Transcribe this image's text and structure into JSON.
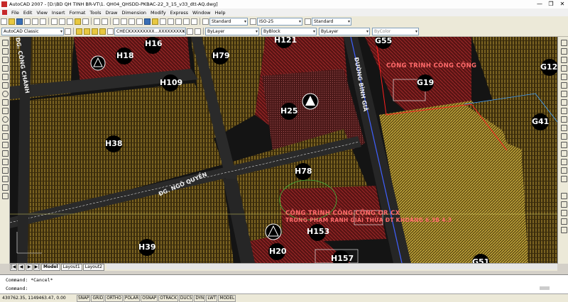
{
  "window": {
    "title": "AutoCAD 2007 - [D:\\BD QH TINH BR-VT\\1. QH04_QHSDD-PKBAC-22_3_15_v33_dtt-AQ.dwg]",
    "minimize_label": "—",
    "maximize_label": "❐",
    "close_label": "✕"
  },
  "menu": {
    "items": [
      "File",
      "Edit",
      "View",
      "Insert",
      "Format",
      "Tools",
      "Draw",
      "Dimension",
      "Modify",
      "Express",
      "Window",
      "Help"
    ]
  },
  "toolbar": {
    "text_style": "Standard",
    "dim_style": "ISO-25",
    "table_style": "Standard",
    "workspace": "AutoCAD Classic",
    "layer": "CHECKXXXXXXXX...XXXXXXXXXXXXX",
    "color": "ByLayer",
    "linetype": "ByBlock",
    "lineweight": "ByLayer",
    "plotstyle": "ByColor"
  },
  "drawing": {
    "lot_labels": [
      "H16",
      "H18",
      "H79",
      "H121",
      "G55",
      "G12",
      "H109",
      "G19",
      "H25",
      "G41",
      "H38",
      "H78",
      "H153",
      "H39",
      "H20",
      "H157",
      "G51"
    ],
    "road_labels": [
      "ĐG. CÔNG CHÁNH",
      "ĐG. NGÔ QUYỀN",
      "ĐƯỜNG BÌNH GIÃ"
    ],
    "zone_labels": [
      "CÔNG TRÌNH CÔNG CỘNG",
      "CÔNG TRÌNH CÔNG CỘNG OR CX",
      "TRONG PHẠM RANH GIẢI THỬA ĐT KHOẢNG  6.3B 4.3"
    ],
    "colors": {
      "residential": "#4a3a12",
      "public": "#6b1a1a",
      "mixed": "#c8a838",
      "road": "#2a2a2a"
    }
  },
  "layout_tabs": {
    "nav": [
      "|◀",
      "◀",
      "▶",
      "▶|"
    ],
    "tabs": [
      "Model",
      "Layout1",
      "Layout2"
    ],
    "active": "Model"
  },
  "command": {
    "line1": "Command: *Cancel*",
    "line2": "Command:"
  },
  "status": {
    "coords": "430762.35, 1149463.47, 0.00",
    "toggles": [
      "SNAP",
      "GRID",
      "ORTHO",
      "POLAR",
      "OSNAP",
      "OTRACK",
      "DUCS",
      "DYN",
      "LWT",
      "MODEL"
    ]
  }
}
